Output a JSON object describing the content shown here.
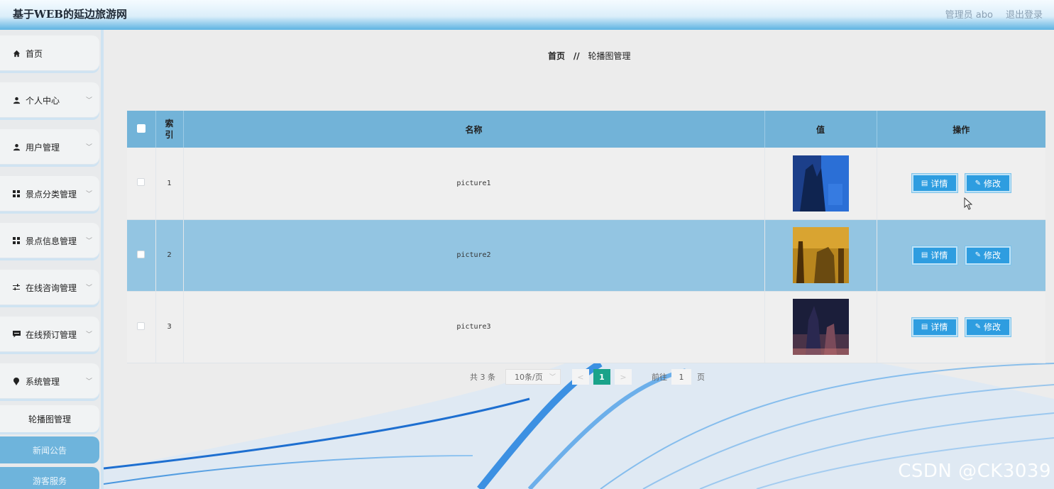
{
  "app": {
    "title": "基于WEB的延边旅游网",
    "user_label": "管理员 abo",
    "logout_label": "退出登录"
  },
  "sidebar": {
    "items": [
      {
        "label": "首页",
        "icon": "home-icon",
        "expandable": false
      },
      {
        "label": "个人中心",
        "icon": "user-icon",
        "expandable": true
      },
      {
        "label": "用户管理",
        "icon": "user-icon",
        "expandable": true
      },
      {
        "label": "景点分类管理",
        "icon": "grid-icon",
        "expandable": true
      },
      {
        "label": "景点信息管理",
        "icon": "grid-icon",
        "expandable": true
      },
      {
        "label": "在线咨询管理",
        "icon": "sliders-icon",
        "expandable": true
      },
      {
        "label": "在线预订管理",
        "icon": "chat-icon",
        "expandable": true
      },
      {
        "label": "系统管理",
        "icon": "pin-icon",
        "expandable": true
      }
    ],
    "submenu": [
      {
        "label": "轮播图管理",
        "active": true
      },
      {
        "label": "新闻公告",
        "active": false
      },
      {
        "label": "游客服务",
        "active": false
      }
    ]
  },
  "breadcrumb": {
    "home": "首页",
    "separator": "//",
    "current": "轮播图管理"
  },
  "table": {
    "headers": {
      "index": "索引",
      "name": "名称",
      "value": "值",
      "actions": "操作"
    },
    "rows": [
      {
        "index": "1",
        "name": "picture1",
        "thumb_colors": [
          "#1c3f8a",
          "#2b6fd6"
        ]
      },
      {
        "index": "2",
        "name": "picture2",
        "thumb_colors": [
          "#6a4a10",
          "#b8861e"
        ]
      },
      {
        "index": "3",
        "name": "picture3",
        "thumb_colors": [
          "#1b1e3a",
          "#7a4a5a"
        ]
      }
    ],
    "detail_label": "详情",
    "edit_label": "修改"
  },
  "pagination": {
    "total_text": "共 3 条",
    "page_size": "10条/页",
    "prev": "<",
    "current_page": "1",
    "next": ">",
    "goto_label": "前往",
    "goto_value": "1",
    "page_suffix": "页"
  },
  "watermark": "CSDN @CK3039",
  "colors": {
    "accent": "#2e9de0",
    "table_header": "#72b3d8",
    "row_highlight": "#93c5e2",
    "pager_active": "#1aa38a"
  }
}
